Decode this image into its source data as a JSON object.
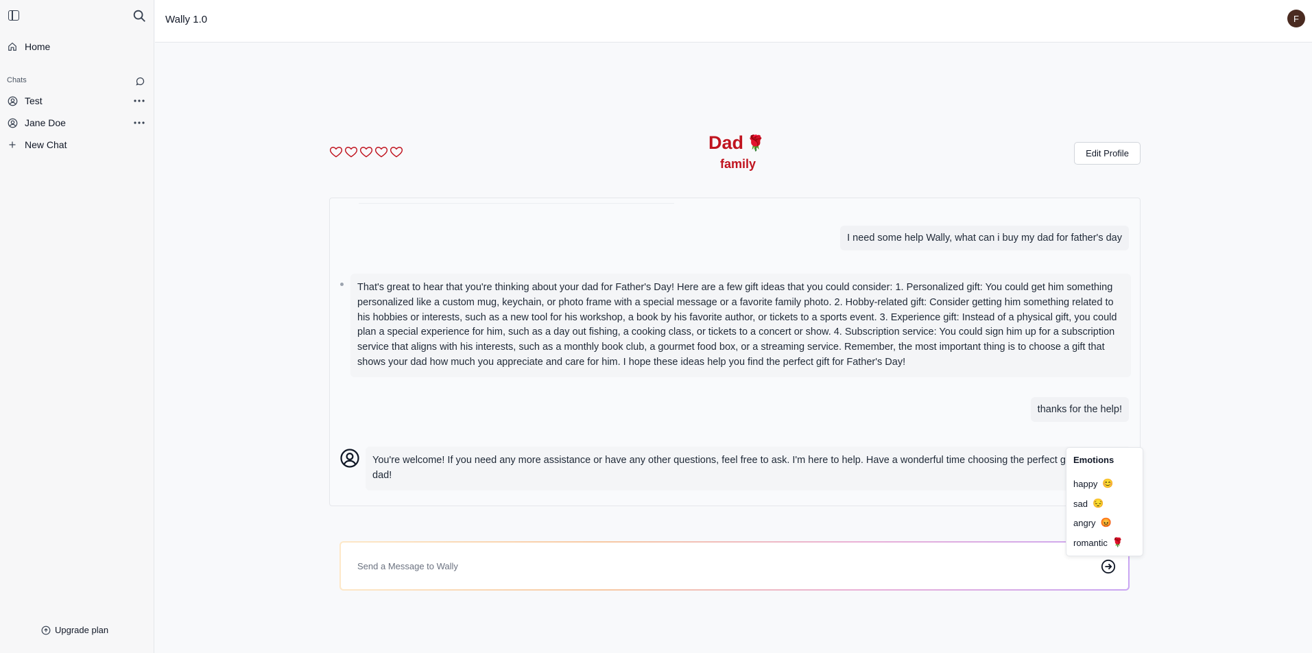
{
  "sidebar": {
    "home_label": "Home",
    "chats_label": "Chats",
    "chats": [
      {
        "label": "Test"
      },
      {
        "label": "Jane Doe"
      }
    ],
    "new_chat_label": "New Chat",
    "upgrade_label": "Upgrade plan"
  },
  "header": {
    "title": "Wally 1.0",
    "avatar_letter": "F"
  },
  "profile": {
    "name": "Dad",
    "name_emoji": "🌹",
    "relation": "family",
    "hearts_filled": 0,
    "hearts_total": 5,
    "edit_label": "Edit Profile"
  },
  "messages": [
    {
      "role": "user",
      "text": "I need some help Wally, what can i buy my dad for father's day"
    },
    {
      "role": "assistant",
      "text": "That's great to hear that you're thinking about your dad for Father's Day! Here are a few gift ideas that you could consider: 1. Personalized gift: You could get him something personalized like a custom mug, keychain, or photo frame with a special message or a favorite family photo. 2. Hobby-related gift: Consider getting him something related to his hobbies or interests, such as a new tool for his workshop, a book by his favorite author, or tickets to a sports event. 3. Experience gift: Instead of a physical gift, you could plan a special experience for him, such as a day out fishing, a cooking class, or tickets to a concert or show. 4. Subscription service: You could sign him up for a subscription service that aligns with his interests, such as a monthly book club, a gourmet food box, or a streaming service. Remember, the most important thing is to choose a gift that shows your dad how much you appreciate and care for him. I hope these ideas help you find the perfect gift for Father's Day!"
    },
    {
      "role": "user",
      "text": "thanks for the help!"
    },
    {
      "role": "assistant",
      "text": "You're welcome! If you need any more assistance or have any other questions, feel free to ask. I'm here to help. Have a wonderful time choosing the perfect gift for your dad!"
    }
  ],
  "emotions_menu": {
    "title": "Emotions",
    "options": [
      {
        "label": "happy",
        "emoji": "😊"
      },
      {
        "label": "sad",
        "emoji": "😔"
      },
      {
        "label": "angry",
        "emoji": "😡"
      },
      {
        "label": "romantic",
        "emoji": "🌹"
      }
    ]
  },
  "composer": {
    "placeholder": "Send a Message to Wally"
  },
  "colors": {
    "accent": "#c0141f",
    "avatar_bg": "#4a2b21"
  }
}
